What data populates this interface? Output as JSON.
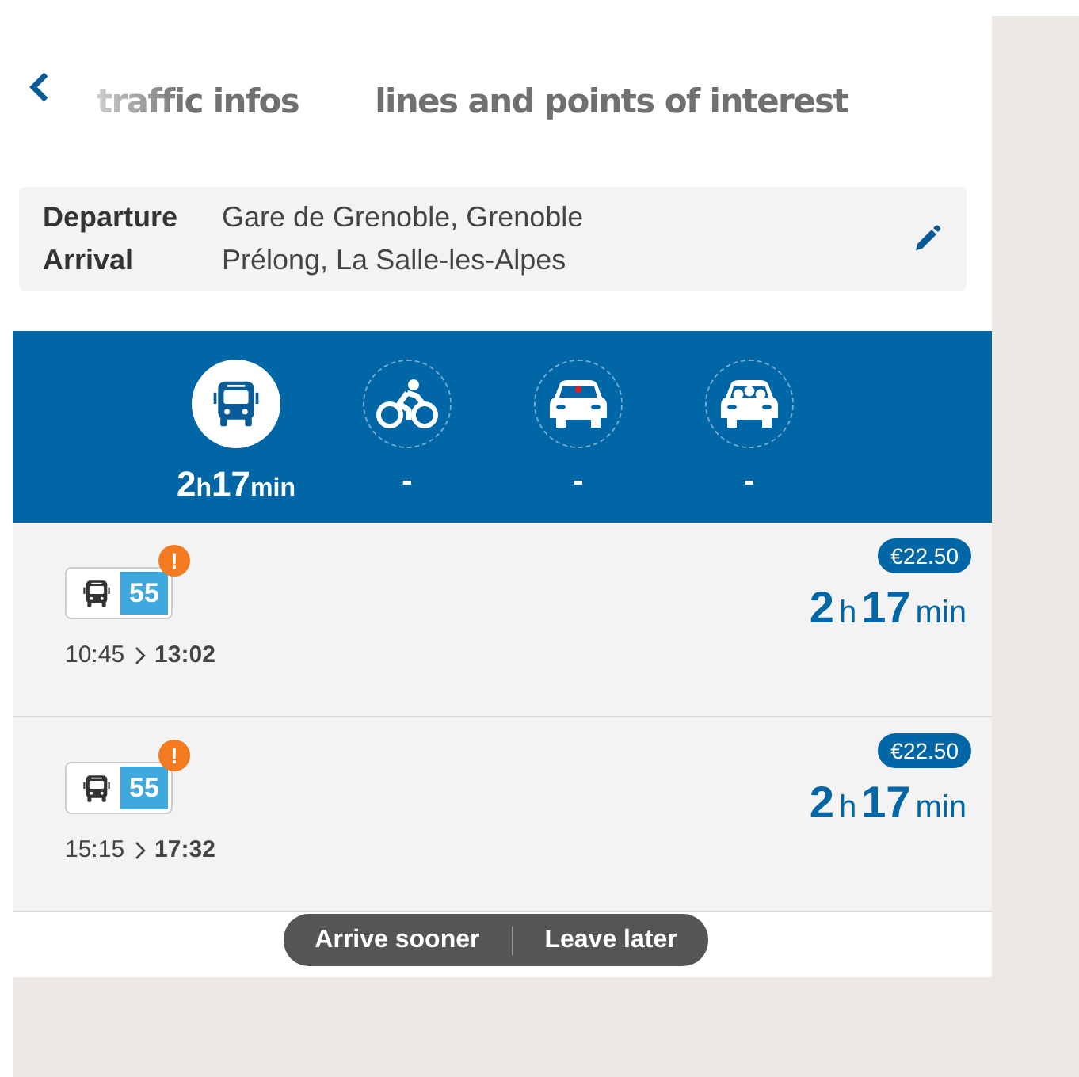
{
  "header": {
    "tabs": [
      {
        "label": "traffic infos",
        "faded": true
      },
      {
        "label": "lines and points of interest",
        "faded": false
      }
    ]
  },
  "route": {
    "departure_label": "Departure",
    "departure": "Gare de Grenoble, Grenoble",
    "arrival_label": "Arrival",
    "arrival": "Prélong, La Salle-les-Alpes"
  },
  "modes": [
    {
      "kind": "bus",
      "selected": true,
      "duration": {
        "hours": "2",
        "h_unit": "h",
        "minutes": "17",
        "min_unit": "min"
      }
    },
    {
      "kind": "bike",
      "selected": false,
      "empty": "-"
    },
    {
      "kind": "car",
      "selected": false,
      "empty": "-"
    },
    {
      "kind": "carpool",
      "selected": false,
      "empty": "-"
    }
  ],
  "trips": [
    {
      "line": "55",
      "alert": "!",
      "depart": "10:45",
      "arrive": "13:02",
      "price": "€22.50",
      "duration": {
        "hours": "2",
        "h_unit": "h",
        "minutes": "17",
        "min_unit": "min"
      }
    },
    {
      "line": "55",
      "alert": "!",
      "depart": "15:15",
      "arrive": "17:32",
      "price": "€22.50",
      "duration": {
        "hours": "2",
        "h_unit": "h",
        "minutes": "17",
        "min_unit": "min"
      }
    }
  ],
  "actions": [
    "Arrive sooner",
    "Leave later"
  ]
}
